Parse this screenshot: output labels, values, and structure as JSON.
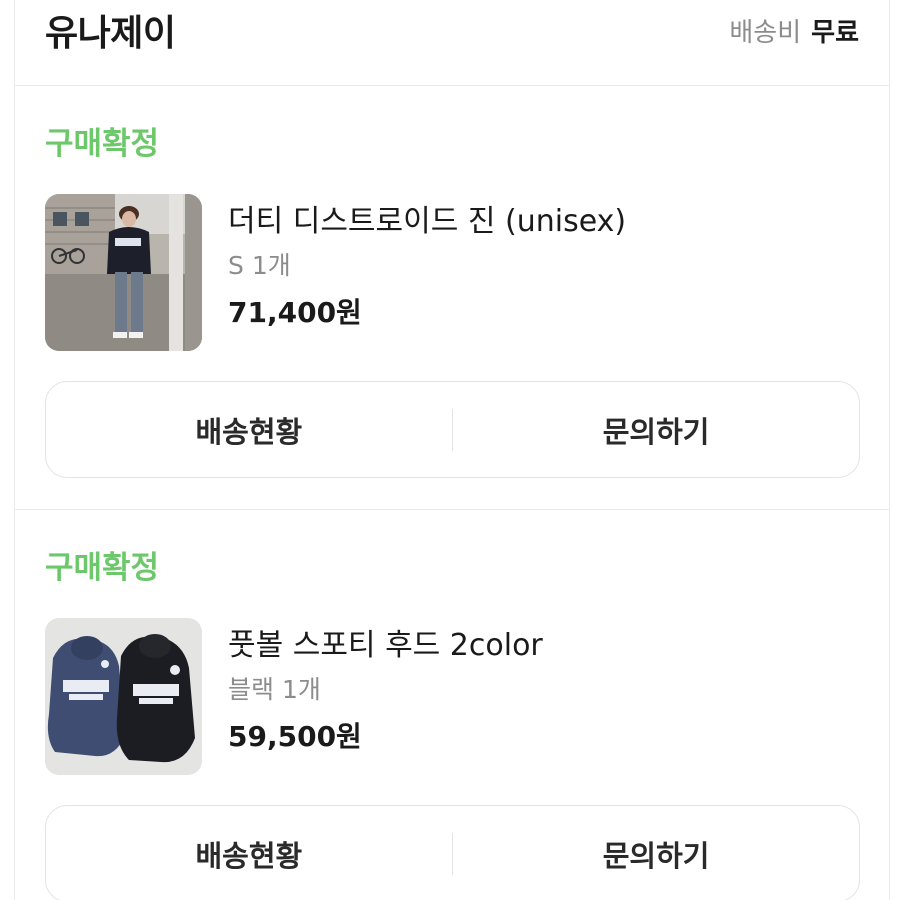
{
  "store": {
    "name": "유나제이",
    "shipping_label": "배송비",
    "shipping_value": "무료"
  },
  "orders": [
    {
      "status": "구매확정",
      "product_name": "더티 디스트로이드 진 (unisex)",
      "option": "S 1개",
      "price": "71,400원",
      "image": "person-in-hoodie-and-jeans-photo",
      "actions": {
        "track": "배송현황",
        "inquire": "문의하기"
      }
    },
    {
      "status": "구매확정",
      "product_name": "풋볼 스포티 후드 2color",
      "option": "블랙 1개",
      "price": "59,500원",
      "image": "navy-and-black-hoodies-photo",
      "actions": {
        "track": "배송현황",
        "inquire": "문의하기"
      }
    }
  ],
  "colors": {
    "status_green": "#6cc86a",
    "muted_text": "#8c8c8c",
    "border": "#e3e3e3"
  }
}
